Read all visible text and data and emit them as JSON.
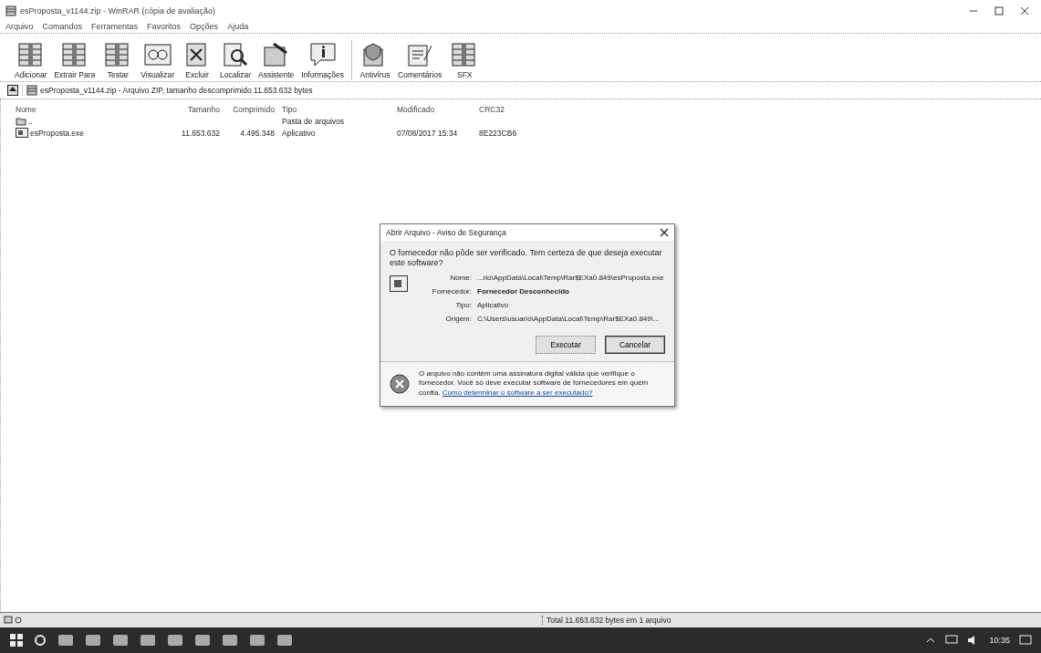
{
  "window": {
    "title": "esProposta_v1144.zip - WinRAR (cópia de avaliação)"
  },
  "menu": [
    "Arquivo",
    "Comandos",
    "Ferramentas",
    "Favoritos",
    "Opções",
    "Ajuda"
  ],
  "toolbar": [
    {
      "label": "Adicionar",
      "kind": "archive"
    },
    {
      "label": "Extrair Para",
      "kind": "extract"
    },
    {
      "label": "Testar",
      "kind": "test"
    },
    {
      "label": "Visualizar",
      "kind": "view"
    },
    {
      "label": "Excluir",
      "kind": "delete"
    },
    {
      "label": "Localizar",
      "kind": "find"
    },
    {
      "label": "Assistente",
      "kind": "wizard"
    },
    {
      "label": "Informações",
      "kind": "info"
    },
    {
      "label": "Antivírus",
      "kind": "antivirus",
      "group_start": true
    },
    {
      "label": "Comentários",
      "kind": "comment"
    },
    {
      "label": "SFX",
      "kind": "sfx"
    }
  ],
  "address": "esProposta_v1144.zip - Arquivo ZIP, tamanho descomprimido 11.653.632 bytes",
  "table": {
    "columns": [
      "Nome",
      "Tamanho",
      "Comprimido",
      "Tipo",
      "Modificado",
      "CRC32"
    ],
    "rows": [
      {
        "kind": "parent",
        "cells": [
          "..",
          "",
          "",
          "Pasta de arquivos",
          "",
          ""
        ]
      },
      {
        "kind": "file",
        "cells": [
          "esProposta.exe",
          "11.653.632",
          "4.495.348",
          "Aplicativo",
          "07/08/2017 15:34",
          "8E223CB6"
        ]
      }
    ]
  },
  "dialog": {
    "title": "Abrir Arquivo - Aviso de Segurança",
    "question": "O fornecedor não pôde ser verificado. Tem certeza de que deseja executar este software?",
    "fields": [
      {
        "label": "Nome:",
        "value": "...rio\\AppData\\Local\\Temp\\Rar$EXa0.849\\esProposta.exe",
        "bold": false
      },
      {
        "label": "Fornecedor:",
        "value": "Fornecedor Desconhecido",
        "bold": true
      },
      {
        "label": "Tipo:",
        "value": "Aplicativo",
        "bold": false
      },
      {
        "label": "Origem:",
        "value": "C:\\Users\\usuario\\AppData\\Local\\Temp\\Rar$EXa0.849\\...",
        "bold": false
      }
    ],
    "buttons": [
      {
        "label": "Executar",
        "selected": false
      },
      {
        "label": "Cancelar",
        "selected": true
      }
    ],
    "warning": "O arquivo não contém uma assinatura digital válida que verifique o fornecedor. Você só deve executar software de fornecedores em quem confia.",
    "link": "Como determinar o software a ser executado?"
  },
  "status_bar": "Total 11.653.632 bytes em 1 arquivo",
  "taskbar": {
    "clock": "10:35"
  }
}
